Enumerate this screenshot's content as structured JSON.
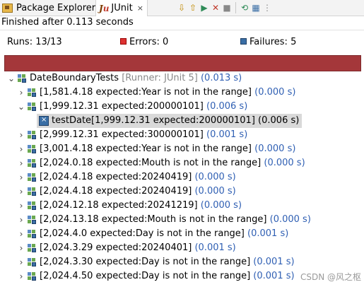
{
  "tabs": {
    "package_explorer": "Package Explorer",
    "junit": "JUnit",
    "junit_close": "×"
  },
  "toolbar_icons": [
    "next-failure-icon",
    "previous-failure-icon",
    "relaunch-icon",
    "relaunch-failed-icon",
    "stop-icon",
    "history-icon",
    "layout-icon",
    "menu-icon"
  ],
  "status": {
    "finished": "Finished after 0.113 seconds",
    "runs_label": "Runs:",
    "runs_value": "13/13",
    "errors_label": "Errors:",
    "errors_value": "0",
    "failures_label": "Failures:",
    "failures_value": "5",
    "progress_color": "#a4373a",
    "progress_fraction": 1.0
  },
  "tree": {
    "root": {
      "name": "DateBoundaryTests",
      "runner": "[Runner: JUnit 5]",
      "time": "(0.013 s)"
    },
    "items": [
      {
        "label": "[1,581.4.18 expected:Year is not in the range]",
        "time": "(0.000 s)",
        "expanded": false
      },
      {
        "label": "[1,999.12.31 expected:200000101]",
        "time": "(0.006 s)",
        "expanded": true,
        "child": {
          "label": "testDate[1,999.12.31 expected:200000101]",
          "time": "(0.006 s)"
        }
      },
      {
        "label": "[2,999.12.31 expected:300000101]",
        "time": "(0.001 s)",
        "expanded": false
      },
      {
        "label": "[3,001.4.18 expected:Year is not in the range]",
        "time": "(0.000 s)",
        "expanded": false
      },
      {
        "label": "[2,024.0.18 expected:Mouth is not in the range]",
        "time": "(0.000 s)",
        "expanded": false
      },
      {
        "label": "[2,024.4.18 expected:20240419]",
        "time": "(0.000 s)",
        "expanded": false
      },
      {
        "label": "[2,024.4.18 expected:20240419]",
        "time": "(0.000 s)",
        "expanded": false
      },
      {
        "label": "[2,024.12.18 expected:20241219]",
        "time": "(0.000 s)",
        "expanded": false
      },
      {
        "label": "[2,024.13.18 expected:Mouth is not in the range]",
        "time": "(0.000 s)",
        "expanded": false
      },
      {
        "label": "[2,024.4.0 expected:Day is not in the range]",
        "time": "(0.001 s)",
        "expanded": false
      },
      {
        "label": "[2,024.3.29 expected:20240401]",
        "time": "(0.001 s)",
        "expanded": false
      },
      {
        "label": "[2,024.3.30 expected:Day is not in the range]",
        "time": "(0.001 s)",
        "expanded": false
      },
      {
        "label": "[2,024.4.50 expected:Day is not in the range]",
        "time": "(0.001 s)",
        "expanded": false
      }
    ]
  },
  "watermark": "CSDN @风之枢"
}
